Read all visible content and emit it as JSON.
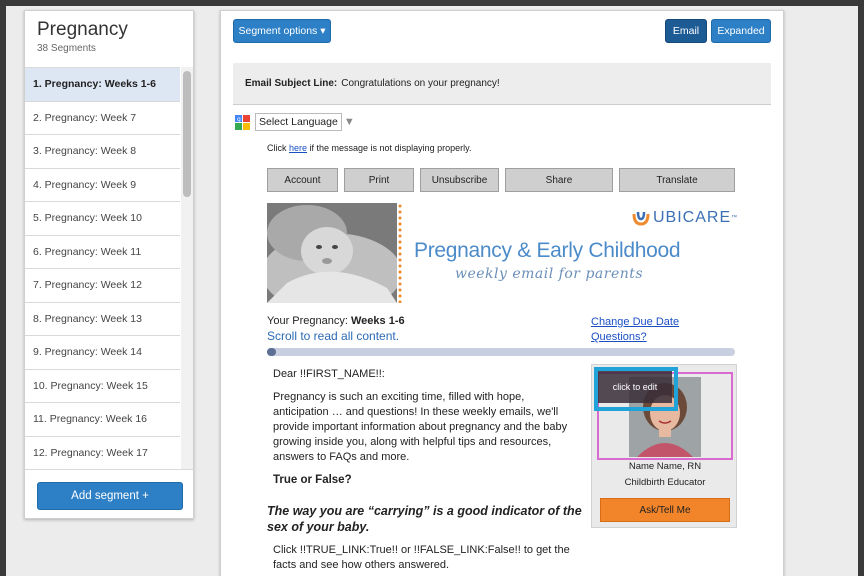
{
  "sidebar": {
    "title": "Pregnancy",
    "subtitle": "38 Segments",
    "items": [
      {
        "label": "1. Pregnancy: Weeks 1-6"
      },
      {
        "label": "2. Pregnancy: Week 7"
      },
      {
        "label": "3. Pregnancy: Week 8"
      },
      {
        "label": "4. Pregnancy: Week 9"
      },
      {
        "label": "5. Pregnancy: Week 10"
      },
      {
        "label": "6. Pregnancy: Week 11"
      },
      {
        "label": "7. Pregnancy: Week 12"
      },
      {
        "label": "8. Pregnancy: Week 13"
      },
      {
        "label": "9. Pregnancy: Week 14"
      },
      {
        "label": "10. Pregnancy: Week 15"
      },
      {
        "label": "11. Pregnancy: Week 16"
      },
      {
        "label": "12. Pregnancy: Week 17"
      }
    ],
    "active_index": 0,
    "add_label": "Add segment +"
  },
  "toolbar": {
    "segment_options": "Segment options ▾",
    "email": "Email",
    "expanded": "Expanded"
  },
  "subject": {
    "label": "Email Subject Line:",
    "value": "Congratulations on your pregnancy!"
  },
  "language": {
    "label": "Select Language",
    "caret": "▼"
  },
  "notice": {
    "before": "Click ",
    "link": "here",
    "after": " if the message is not displaying properly."
  },
  "email_buttons": [
    "Account",
    "Print",
    "Unsubscribe",
    "Share",
    "Translate"
  ],
  "banner": {
    "brand": "UBICARE",
    "brand_tm": "™",
    "title": "Pregnancy & Early Childhood",
    "subtitle": "weekly email for parents"
  },
  "content": {
    "your_pregnancy_label": "Your Pregnancy: ",
    "your_pregnancy_value": "Weeks 1-6",
    "scroll_text": "Scroll to read all content.",
    "due_link_1": "Change Due Date",
    "due_link_2": "Questions?",
    "progress_fraction": 0.02,
    "greeting": "Dear !!FIRST_NAME!!:",
    "paragraph": "Pregnancy is such an exciting time, filled with hope, anticipation … and questions! In these weekly emails, we'll provide important information about pregnancy and the baby growing inside you, along with helpful tips and resources, answers to FAQs and more.",
    "true_false": "True or False?",
    "statement": "The way you are “carrying” is a good indicator of the sex of your baby.",
    "cta": "Click !!TRUE_LINK:True!! or !!FALSE_LINK:False!! to get the facts and see how others answered."
  },
  "educator": {
    "edit_overlay": "click to edit",
    "name": "Name Name, RN",
    "role": "Childbirth Educator",
    "ask": "Ask/Tell Me"
  },
  "colors": {
    "primary": "#2d7fc6",
    "primary_dark": "#1d5b95",
    "accent_orange": "#f2842a",
    "banner_blue": "#4c8bc9",
    "highlight_pink": "#d86bd0",
    "highlight_cyan": "#1fa3d9"
  }
}
